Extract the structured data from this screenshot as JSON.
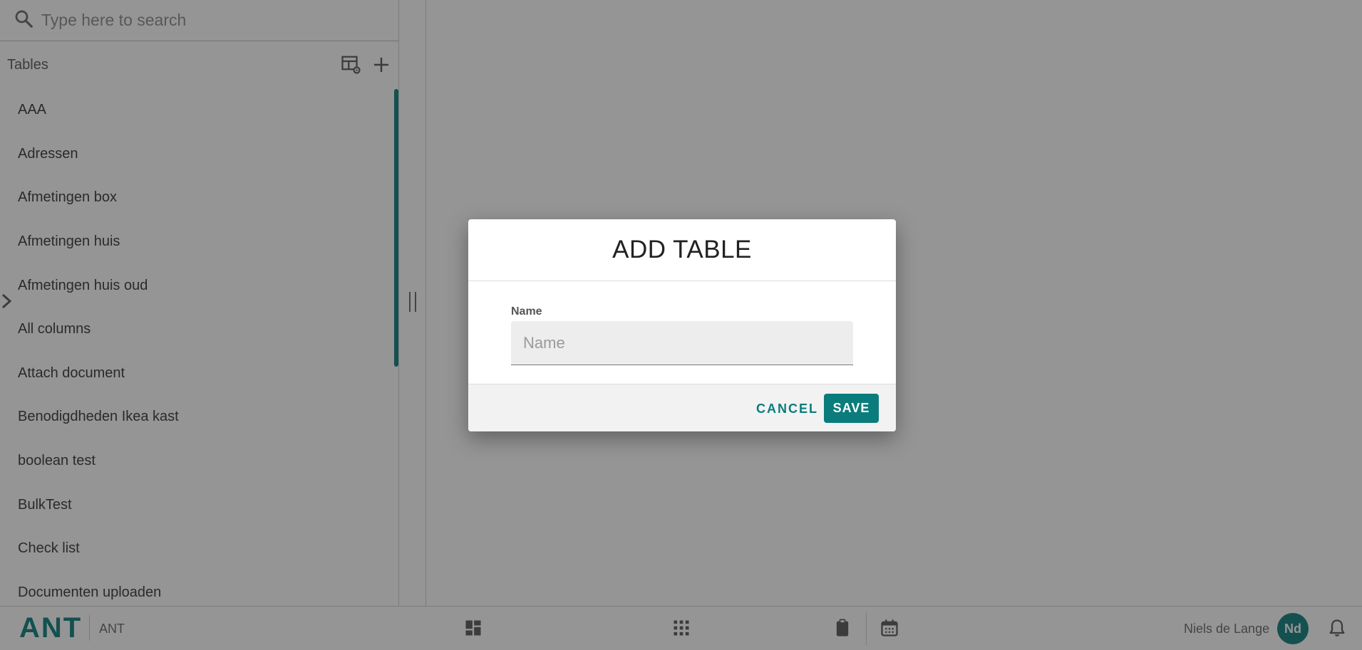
{
  "search": {
    "placeholder": "Type here to search"
  },
  "sidebar": {
    "title": "Tables",
    "items": [
      {
        "label": "AAA"
      },
      {
        "label": "Adressen"
      },
      {
        "label": "Afmetingen box"
      },
      {
        "label": "Afmetingen huis"
      },
      {
        "label": "Afmetingen huis oud"
      },
      {
        "label": "All columns"
      },
      {
        "label": "Attach document"
      },
      {
        "label": "Benodigdheden Ikea kast"
      },
      {
        "label": "boolean test"
      },
      {
        "label": "BulkTest"
      },
      {
        "label": "Check list"
      },
      {
        "label": "Documenten uploaden"
      }
    ]
  },
  "bottom_bar": {
    "logo": "ANT",
    "app_name": "ANT",
    "user_name": "Niels de Lange",
    "user_initials": "Nd"
  },
  "dialog": {
    "title": "ADD TABLE",
    "field_label": "Name",
    "field_placeholder": "Name",
    "field_value": "",
    "cancel_label": "CANCEL",
    "save_label": "SAVE"
  },
  "colors": {
    "accent": "#0a7c7c",
    "overlay": "rgba(33,33,33,0.48)"
  },
  "icons": {
    "search": "search-icon",
    "table_settings": "table-settings-icon",
    "add": "plus-icon",
    "collapse": "chevron-right-icon",
    "splitter": "resize-handle-icon",
    "dashboard": "dashboard-icon",
    "apps": "apps-grid-icon",
    "clipboard": "clipboard-icon",
    "calendar": "calendar-icon",
    "notifications": "bell-icon"
  }
}
